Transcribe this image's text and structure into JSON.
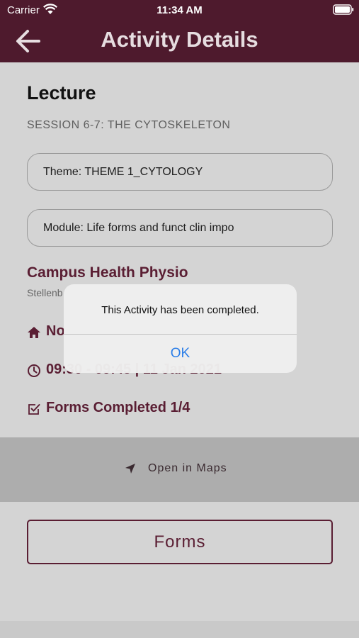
{
  "status_bar": {
    "carrier": "Carrier",
    "time": "11:34 AM"
  },
  "header": {
    "title": "Activity Details",
    "back_icon": "arrow-left-icon"
  },
  "activity": {
    "type": "Lecture",
    "session": "SESSION 6-7: THE CYTOSKELETON",
    "theme": "Theme: THEME 1_CYTOLOGY",
    "module": "Module: Life forms and funct clin impo"
  },
  "venue": {
    "name": "Campus Health Physio",
    "subtitle": "Stellenb"
  },
  "rows": {
    "home_text": "No",
    "time_text": "09:30 - 09:45 | 11 Jan 2021",
    "forms_text": "Forms Completed 1/4"
  },
  "maps": {
    "label": "Open in Maps"
  },
  "forms_button": {
    "label": "Forms"
  },
  "alert": {
    "message": "This Activity has been completed.",
    "ok_label": "OK"
  },
  "colors": {
    "brand": "#4e1a2d",
    "accent_text": "#5a1e33",
    "link": "#2b7ee8"
  }
}
